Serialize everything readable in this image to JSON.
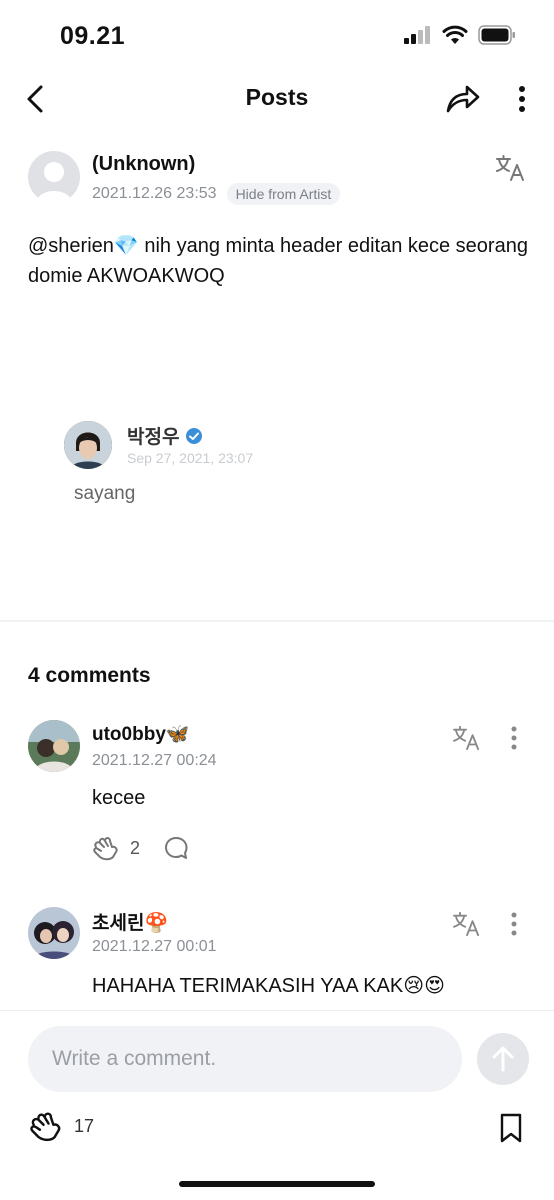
{
  "status_bar": {
    "time": "09.21"
  },
  "nav": {
    "title": "Posts"
  },
  "post": {
    "author": "(Unknown)",
    "date": "2021.12.26 23:53",
    "hide_label": "Hide from Artist",
    "text": "@sherien💎 nih yang minta header editan kece seorang domie AKWOAKWOQ",
    "embed": {
      "name": "박정우",
      "date": "Sep 27, 2021, 23:07",
      "text": "sayang"
    }
  },
  "comments_title": "4 comments",
  "comments": [
    {
      "name": "uto0bby🦋",
      "date": "2021.12.27 00:24",
      "text": "kecee",
      "likes": "2"
    },
    {
      "name": "초세린🍄",
      "date": "2021.12.27 00:01",
      "text": "HAHAHA TERIMAKASIH YAA KAK😢😍"
    }
  ],
  "composer": {
    "placeholder": "Write a comment."
  },
  "footer": {
    "likes": "17"
  }
}
